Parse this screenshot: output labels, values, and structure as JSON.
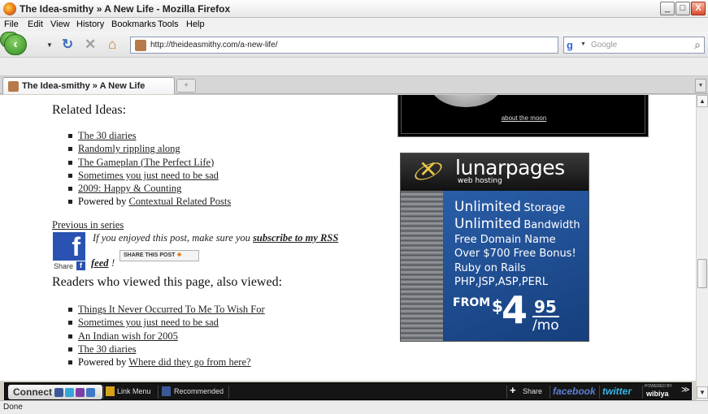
{
  "window": {
    "title": "The Idea-smithy » A New Life - Mozilla Firefox",
    "min": "_",
    "max": "□",
    "close": "X"
  },
  "menu": [
    "File",
    "Edit",
    "View",
    "History",
    "Bookmarks",
    "Tools",
    "Help"
  ],
  "nav": {
    "url": "http://theideasmithy.com/a-new-life/",
    "search_placeholder": "Google",
    "back_icon": "back-arrow-icon",
    "forward_icon": "forward-arrow-icon"
  },
  "tabs": [
    {
      "label": "The Idea-smithy » A New Life"
    }
  ],
  "page": {
    "related_title": "Related Ideas:",
    "related": [
      "The 30 diaries",
      "Randomly rippling along",
      "The Gameplan (The Perfect Life)",
      "Sometimes you just need to be sad",
      "2009: Happy & Counting"
    ],
    "related_powered_prefix": "Powered by",
    "related_powered_link": "Contextual Related Posts",
    "prev_link": "Previous in series",
    "rss_prefix": "If you enjoyed this post, make sure you",
    "rss_link": "subscribe to my RSS",
    "feed_link": "feed",
    "feed_suffix": "!",
    "fb_share_label": "Share",
    "share_this": "SHARE THIS POST",
    "readers_title": "Readers who viewed this page, also viewed:",
    "also_viewed": [
      "Things It Never Occurred To Me To Wish For",
      "Sometimes you just need to be sad",
      "An Indian wish for 2005",
      "The 30 diaries"
    ],
    "also_powered_prefix": "Powered by",
    "also_powered_link": "Where did they go from here?",
    "moon_link": "about the moon"
  },
  "ad": {
    "brand": "lunarpages",
    "sub": "web hosting",
    "lines": [
      {
        "a": "Unlimited",
        "b": "Storage"
      },
      {
        "a": "Unlimited",
        "b": "Bandwidth"
      }
    ],
    "features": [
      "Free Domain Name",
      "Over $700 Free Bonus!",
      "Ruby on Rails",
      "PHP,JSP,ASP,PERL"
    ],
    "from": "FROM",
    "dollar": "$",
    "price_int": "4",
    "price_cents": "95",
    "per": "/mo"
  },
  "wibiya": {
    "connect": "Connect",
    "link_menu": "Link Menu",
    "recommended": "Recommended",
    "share": "Share",
    "facebook": "facebook",
    "twitter": "twitter",
    "powered": "POWERED BY",
    "wibiya": "wibiya",
    "collapse": "≫"
  },
  "status": "Done",
  "colors": {
    "facebook": "#2952b2",
    "ad_blue": "#1d4a8f",
    "toolbar_dark": "#151515"
  }
}
